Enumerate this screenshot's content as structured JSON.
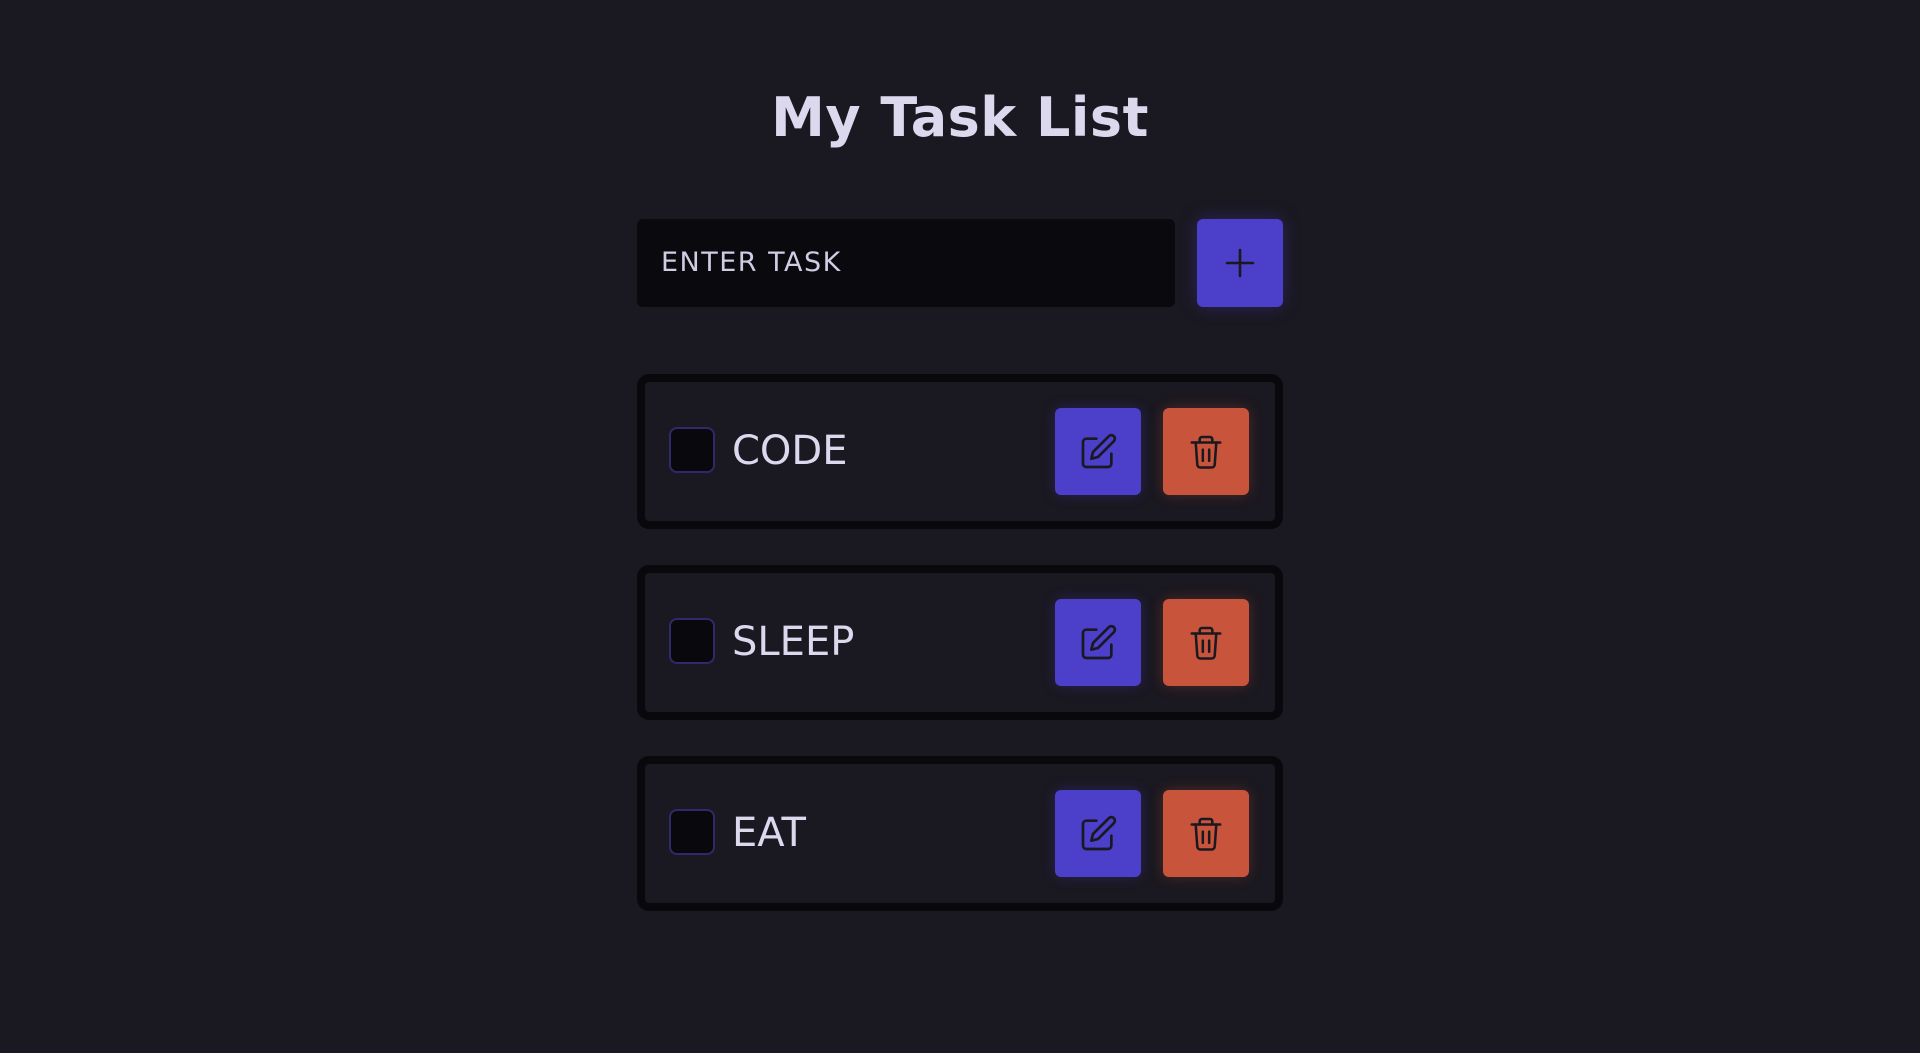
{
  "header": {
    "title": "My Task List"
  },
  "new_task": {
    "placeholder": "ENTER TASK",
    "value": "",
    "add_icon": "plus-icon"
  },
  "tasks": [
    {
      "label": "CODE",
      "checked": false,
      "edit_icon": "pencil-icon",
      "delete_icon": "trash-icon"
    },
    {
      "label": "SLEEP",
      "checked": false,
      "edit_icon": "pencil-icon",
      "delete_icon": "trash-icon"
    },
    {
      "label": "EAT",
      "checked": false,
      "edit_icon": "pencil-icon",
      "delete_icon": "trash-icon"
    }
  ],
  "colors": {
    "background": "#1a1820",
    "primary": "#4c3fc9",
    "danger": "#c8553b",
    "text": "#dcd9ef",
    "input_bg": "#0a090e"
  }
}
